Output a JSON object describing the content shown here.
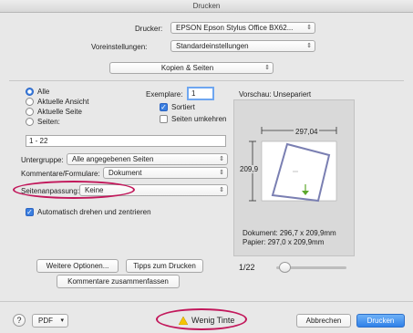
{
  "window": {
    "title": "Drucken"
  },
  "printer": {
    "label": "Drucker:",
    "value": "EPSON Epson Stylus Office BX62..."
  },
  "presets": {
    "label": "Voreinstellungen:",
    "value": "Standardeinstellungen"
  },
  "section": {
    "value": "Kopien & Seiten"
  },
  "pages": {
    "options": [
      "Alle",
      "Aktuelle Ansicht",
      "Aktuelle Seite",
      "Seiten:"
    ],
    "selected": "Alle",
    "range_value": "1 - 22"
  },
  "copies": {
    "label": "Exemplare:",
    "value": "1",
    "sorted_label": "Sortiert",
    "sorted": true,
    "reverse_label": "Seiten umkehren",
    "reverse": false
  },
  "subset": {
    "label": "Untergruppe:",
    "value": "Alle angegebenen Seiten"
  },
  "comments": {
    "label": "Kommentare/Formulare:",
    "value": "Dokument"
  },
  "fit": {
    "label": "Seitenanpassung:",
    "value": "Keine"
  },
  "autorotate": {
    "label": "Automatisch drehen und zentrieren",
    "checked": true
  },
  "preview": {
    "title": "Vorschau: Unsepariert",
    "width_label": "297,04",
    "height_label": "209,9",
    "doc_size": "Dokument: 296,7 x 209,9mm",
    "paper_size": "Papier: 297,0 x 209,9mm",
    "page_indicator": "1/22"
  },
  "buttons": {
    "more_options": "Weitere Optionen...",
    "tips": "Tipps zum Drucken",
    "summarize": "Kommentare zusammenfassen",
    "help": "?",
    "pdf": "PDF",
    "low_ink": "Wenig Tinte",
    "cancel": "Abbrechen",
    "print": "Drucken"
  },
  "icons": {
    "help": "question-icon",
    "warning": "warning-triangle-icon",
    "arrow": "chevron-down-icon"
  },
  "colors": {
    "accent": "#2f80e8",
    "highlight_oval": "#c2185b",
    "warning": "#f5c400"
  }
}
